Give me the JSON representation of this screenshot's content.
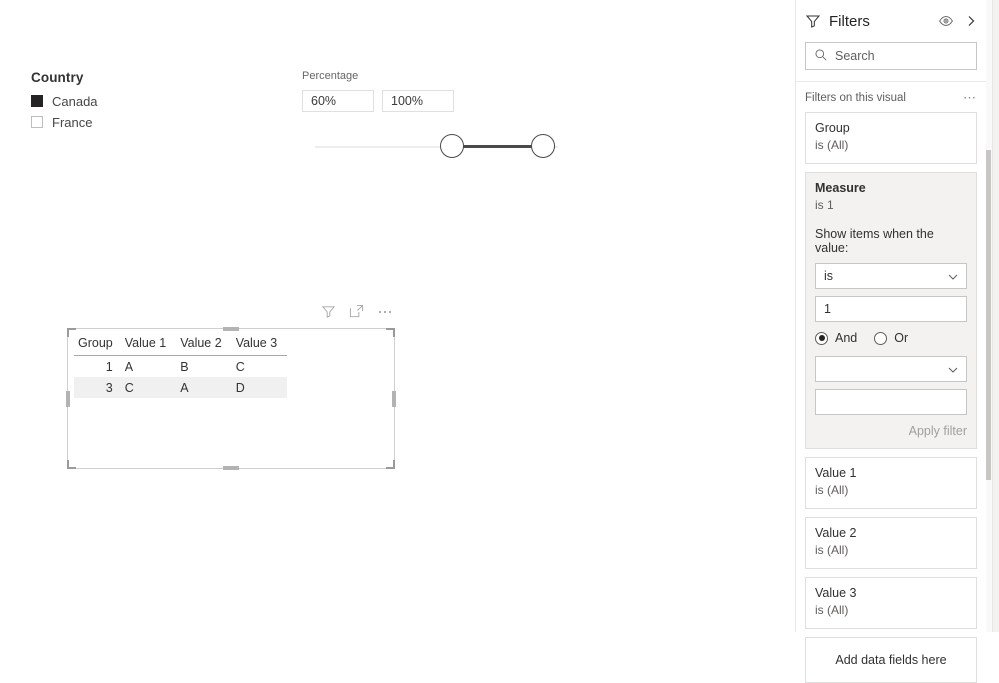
{
  "canvas": {
    "country_slicer": {
      "title": "Country",
      "items": [
        {
          "label": "Canada",
          "checked": true
        },
        {
          "label": "France",
          "checked": false
        }
      ]
    },
    "percentage_slicer": {
      "title": "Percentage",
      "min_value": "60%",
      "max_value": "100%"
    },
    "table_visual": {
      "header_icons": [
        "filter-icon",
        "focus-mode-icon",
        "more-options-icon"
      ],
      "columns": [
        "Group",
        "Value 1",
        "Value 2",
        "Value 3"
      ],
      "rows": [
        {
          "group": "1",
          "v1": "A",
          "v2": "B",
          "v3": "C"
        },
        {
          "group": "3",
          "v1": "C",
          "v2": "A",
          "v3": "D"
        }
      ]
    }
  },
  "filters_pane": {
    "title": "Filters",
    "search_placeholder": "Search",
    "search_value": "",
    "section_title": "Filters on this visual",
    "cards": [
      {
        "title": "Group",
        "sub": "is (All)",
        "expanded": false
      },
      {
        "title": "Measure",
        "sub": "is 1",
        "expanded": true
      },
      {
        "title": "Value 1",
        "sub": "is (All)",
        "expanded": false
      },
      {
        "title": "Value 2",
        "sub": "is (All)",
        "expanded": false
      },
      {
        "title": "Value 3",
        "sub": "is (All)",
        "expanded": false
      }
    ],
    "measure_detail": {
      "prompt": "Show items when the value:",
      "condition_1": "is",
      "value_1": "1",
      "and_label": "And",
      "or_label": "Or",
      "logic_selected": "And",
      "condition_2": "",
      "value_2": "",
      "apply_label": "Apply filter"
    },
    "drop_zone_label": "Add data fields here"
  }
}
